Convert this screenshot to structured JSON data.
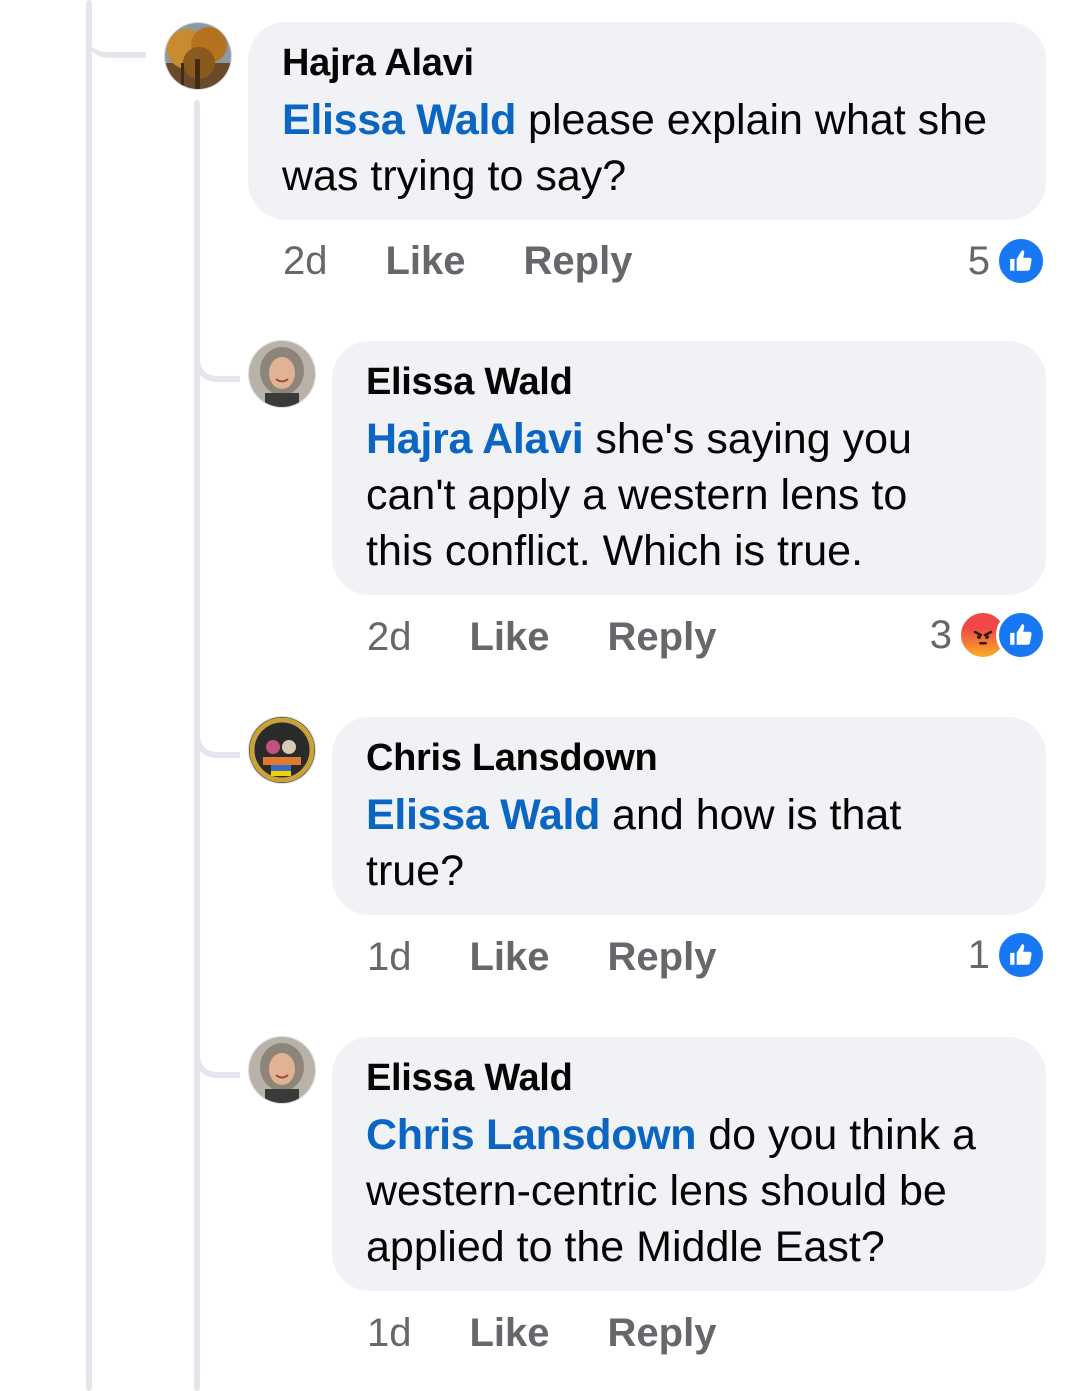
{
  "comments": [
    {
      "author": "Hajra Alavi",
      "mention": "Elissa Wald",
      "text_line1": " please explain what she",
      "text_line2": "was trying to say?",
      "time": "2d",
      "like_label": "Like",
      "reply_label": "Reply",
      "reaction_count": "5",
      "reactions": [
        "like-icon"
      ],
      "avatar": "tree-photo"
    },
    {
      "author": "Elissa Wald",
      "mention": "Hajra Alavi",
      "text_line1": " she's saying you",
      "text_line2": "can't apply a western lens to",
      "text_line3": "this conflict. Which is true.",
      "time": "2d",
      "like_label": "Like",
      "reply_label": "Reply",
      "reaction_count": "3",
      "reactions": [
        "angry-icon",
        "like-icon"
      ],
      "avatar": "woman-portrait"
    },
    {
      "author": "Chris Lansdown",
      "mention": "Elissa Wald",
      "text_line1": " and how is that",
      "text_line2": "true?",
      "time": "1d",
      "like_label": "Like",
      "reply_label": "Reply",
      "reaction_count": "1",
      "reactions": [
        "like-icon"
      ],
      "avatar": "group-photo-badge"
    },
    {
      "author": "Elissa Wald",
      "mention": "Chris Lansdown",
      "text_line1": " do you think a",
      "text_line2": "western-centric lens should be",
      "text_line3": "applied to the Middle East?",
      "time": "1d",
      "like_label": "Like",
      "reply_label": "Reply",
      "avatar": "woman-portrait"
    }
  ],
  "colors": {
    "bubble": "#f0f2f5",
    "mention": "#0a66c2",
    "meta": "#65676b",
    "like": "#1877f2",
    "thread": "#e4e6eb"
  }
}
